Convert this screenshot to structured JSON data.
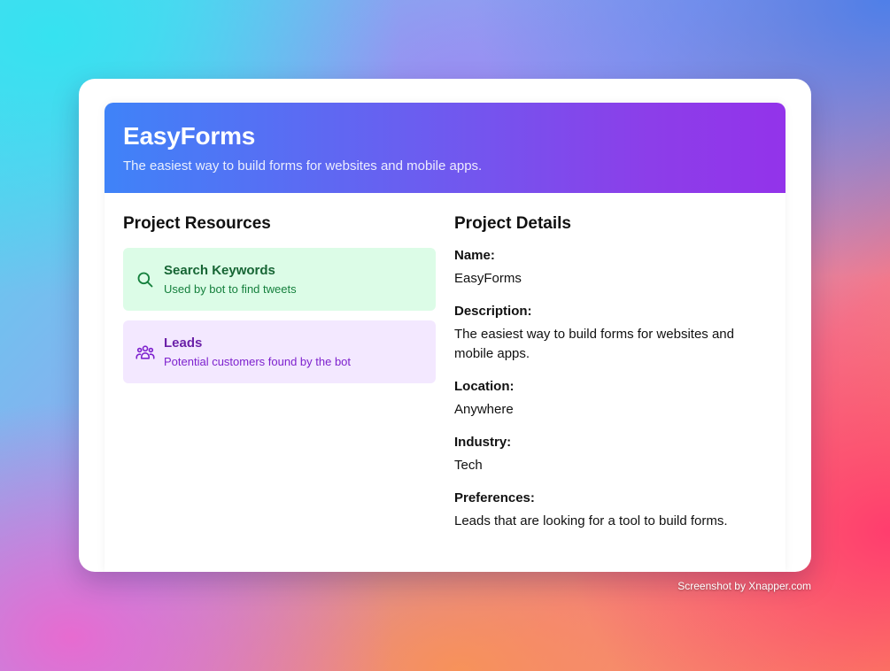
{
  "hero": {
    "title": "EasyForms",
    "subtitle": "The easiest way to build forms for websites and mobile apps."
  },
  "resources": {
    "heading": "Project Resources",
    "items": [
      {
        "title": "Search Keywords",
        "subtitle": "Used by bot to find tweets",
        "icon": "search-icon",
        "color": "#15803d"
      },
      {
        "title": "Leads",
        "subtitle": "Potential customers found by the bot",
        "icon": "users-icon",
        "color": "#7e22ce"
      }
    ]
  },
  "details": {
    "heading": "Project Details",
    "fields": [
      {
        "label": "Name:",
        "value": "EasyForms"
      },
      {
        "label": "Description:",
        "value": "The easiest way to build forms for websites and mobile apps."
      },
      {
        "label": "Location:",
        "value": "Anywhere"
      },
      {
        "label": "Industry:",
        "value": "Tech"
      },
      {
        "label": "Preferences:",
        "value": "Leads that are looking for a tool to build forms."
      }
    ]
  },
  "watermark": "Screenshot by Xnapper.com",
  "colors": {
    "hero_start": "#3f83f8",
    "hero_end": "#9333ea",
    "green_bg": "#dcfce7",
    "purple_bg": "#f3e8ff"
  }
}
